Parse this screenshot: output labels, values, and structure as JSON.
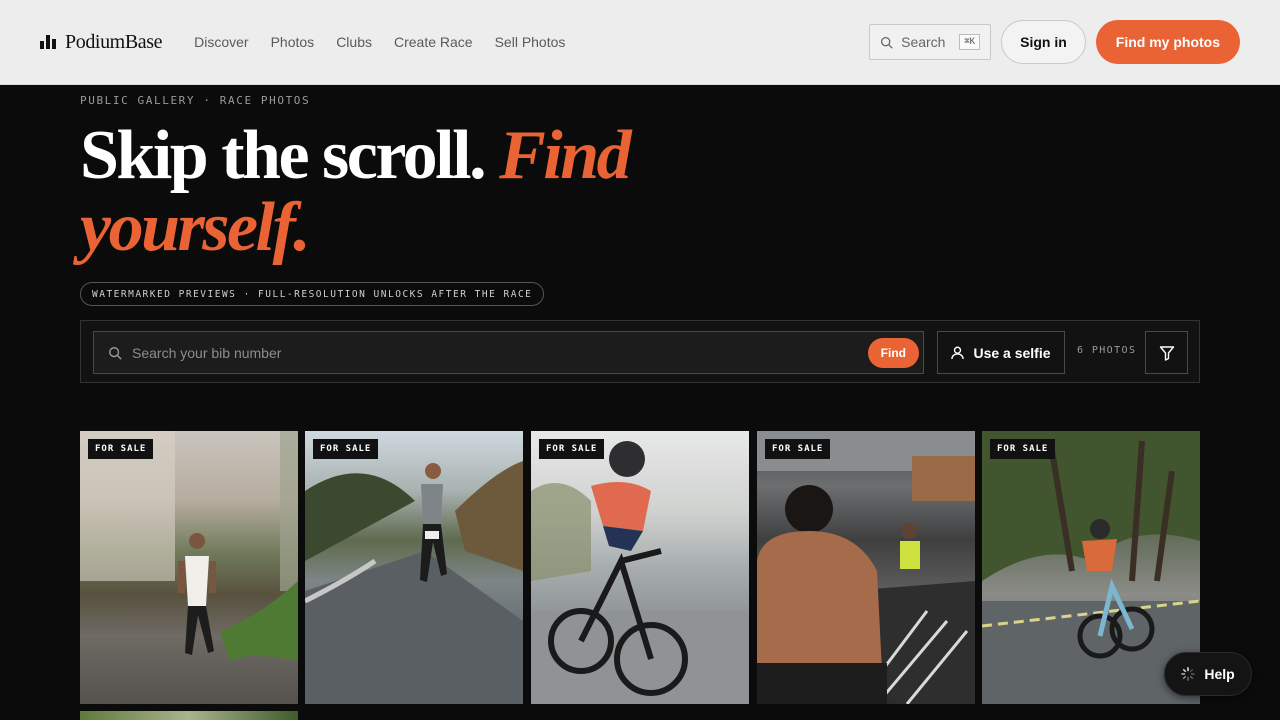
{
  "nav": {
    "brand": "PodiumBase",
    "links": [
      "Discover",
      "Photos",
      "Clubs",
      "Create Race",
      "Sell Photos"
    ],
    "search_label": "Search",
    "search_shortcut": "⌘K",
    "signin": "Sign in",
    "cta": "Find my photos"
  },
  "hero": {
    "eyebrow": "PUBLIC GALLERY · RACE PHOTOS",
    "headline_plain": "Skip the scroll. ",
    "headline_accent": "Find yourself.",
    "pill": "WATERMARKED PREVIEWS · FULL-RESOLUTION UNLOCKS AFTER THE RACE"
  },
  "search": {
    "placeholder": "Search your bib number",
    "find": "Find",
    "selfie": "Use a selfie",
    "count": "6 PHOTOS"
  },
  "gallery": {
    "badge": "FOR SALE",
    "photos": [
      {
        "badge": "FOR SALE"
      },
      {
        "badge": "FOR SALE"
      },
      {
        "badge": "FOR SALE"
      },
      {
        "badge": "FOR SALE"
      },
      {
        "badge": "FOR SALE"
      }
    ]
  },
  "help": {
    "label": "Help"
  },
  "colors": {
    "accent": "#ea6335",
    "background": "#0b0b0b",
    "nav": "#ededed"
  },
  "icons": [
    "podium-logo-icon",
    "search-icon",
    "user-icon",
    "filter-icon",
    "spinner-icon"
  ]
}
